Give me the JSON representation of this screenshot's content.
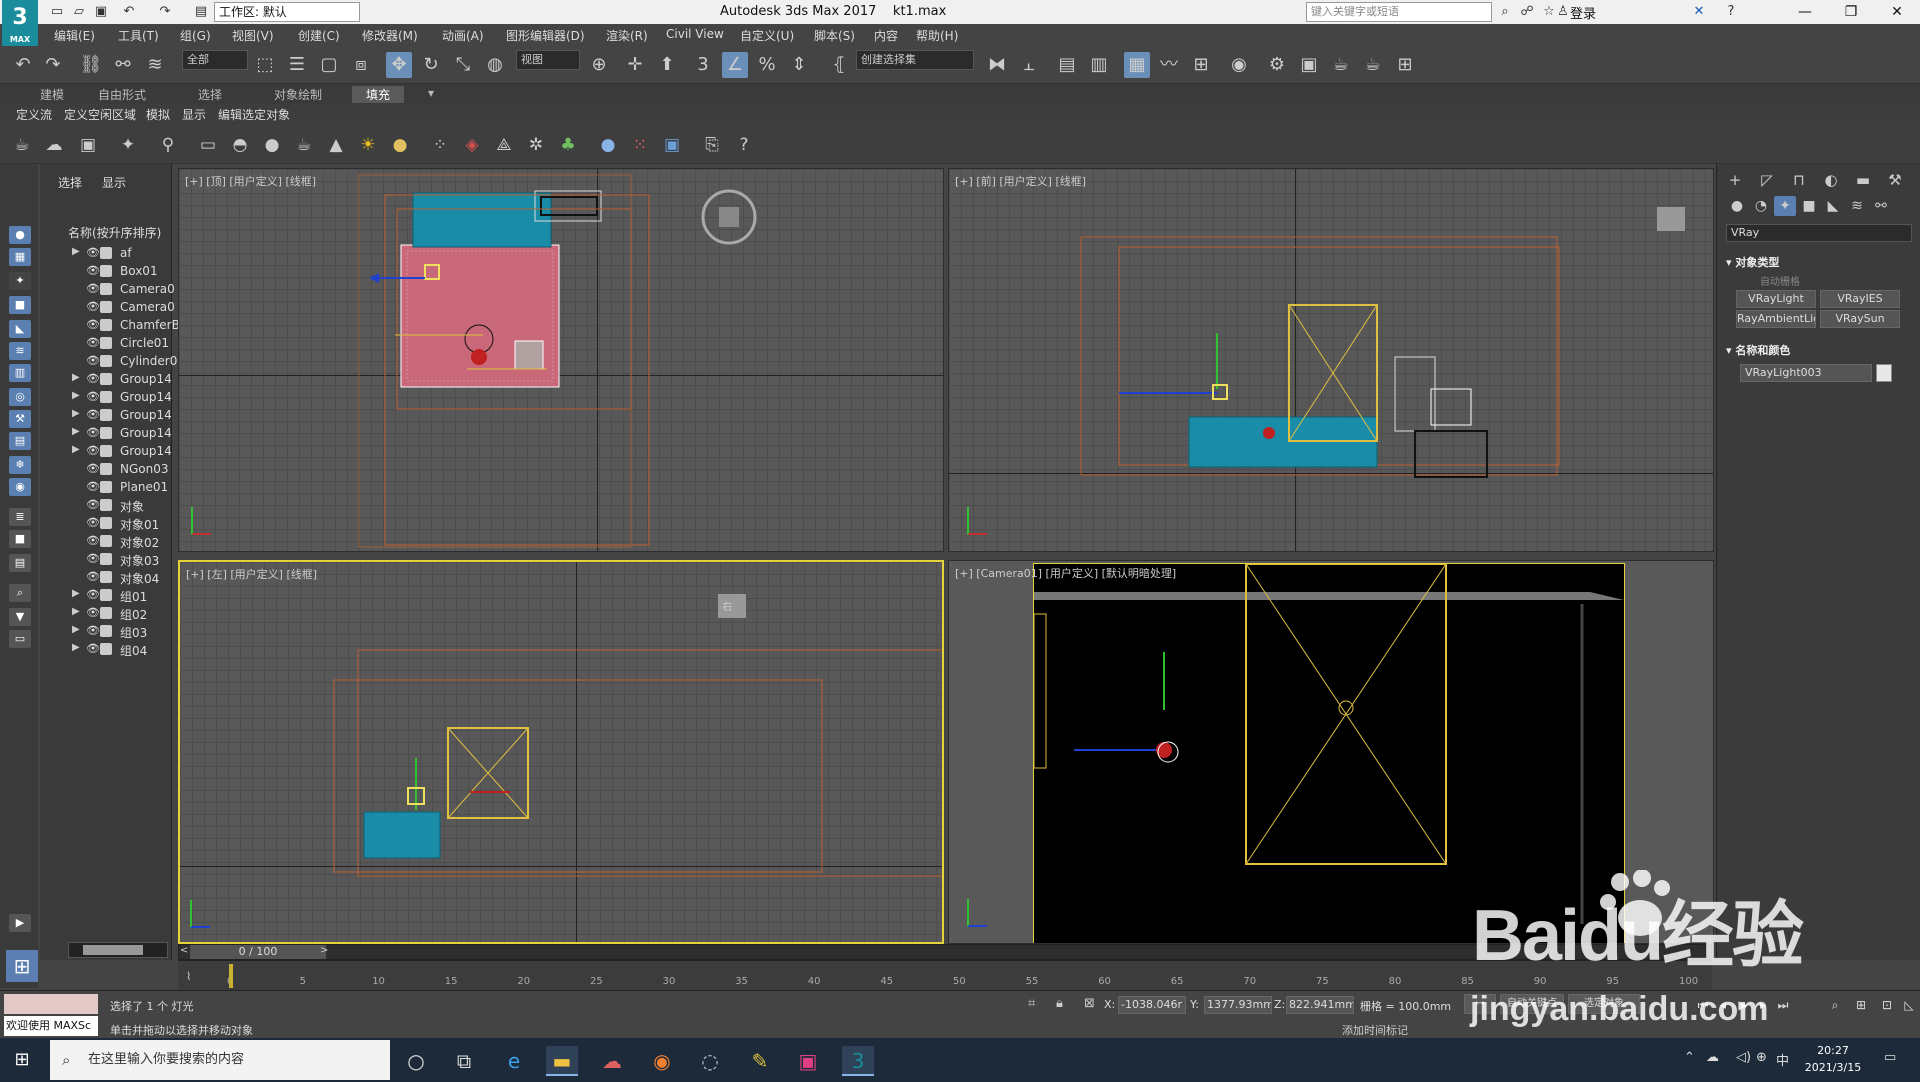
{
  "titlebar": {
    "logo_text": "3",
    "logo_sub": "MAX",
    "workspace": "工作区: 默认",
    "app_title": "Autodesk 3ds Max 2017",
    "file_name": "kt1.max",
    "search_placeholder": "键入关键字或短语",
    "login": "登录",
    "help": "?"
  },
  "menu": [
    "编辑(E)",
    "工具(T)",
    "组(G)",
    "视图(V)",
    "创建(C)",
    "修改器(M)",
    "动画(A)",
    "图形编辑器(D)",
    "渲染(R)",
    "Civil View",
    "自定义(U)",
    "脚本(S)",
    "内容",
    "帮助(H)"
  ],
  "toolbar": {
    "selection_filter": "全部",
    "ref_coord": "视图",
    "named_selection": "创建选择集"
  },
  "ribbon": {
    "tabs": [
      "建模",
      "自由形式",
      "选择",
      "对象绘制",
      "填充"
    ],
    "active_tab": "填充",
    "sub_items": [
      "定义流",
      "定义空闲区域",
      "模拟",
      "显示",
      "编辑选定对象"
    ]
  },
  "explorer": {
    "tabs": [
      "选择",
      "显示"
    ],
    "header": "名称(按升序排序)",
    "items": [
      {
        "name": "af",
        "expandable": true
      },
      {
        "name": "Box01",
        "expandable": false
      },
      {
        "name": "Camera0",
        "expandable": false
      },
      {
        "name": "Camera0",
        "expandable": false
      },
      {
        "name": "ChamferB",
        "expandable": false
      },
      {
        "name": "Circle01",
        "expandable": false
      },
      {
        "name": "Cylinder0",
        "expandable": false
      },
      {
        "name": "Group14",
        "expandable": true
      },
      {
        "name": "Group14",
        "expandable": true
      },
      {
        "name": "Group14",
        "expandable": true
      },
      {
        "name": "Group14",
        "expandable": true
      },
      {
        "name": "Group14",
        "expandable": true
      },
      {
        "name": "NGon03",
        "expandable": false
      },
      {
        "name": "Plane01",
        "expandable": false
      },
      {
        "name": "对象",
        "expandable": false
      },
      {
        "name": "对象01",
        "expandable": false
      },
      {
        "name": "对象02",
        "expandable": false
      },
      {
        "name": "对象03",
        "expandable": false
      },
      {
        "name": "对象04",
        "expandable": false
      },
      {
        "name": "组01",
        "expandable": true
      },
      {
        "name": "组02",
        "expandable": true
      },
      {
        "name": "组03",
        "expandable": true
      },
      {
        "name": "组04",
        "expandable": true
      }
    ]
  },
  "viewports": {
    "top": "[+] [顶] [用户定义] [线框]",
    "front": "[+] [前] [用户定义] [线框]",
    "left": "[+] [左] [用户定义] [线框]",
    "camera": "[+] [Camera01] [用户定义] [默认明暗处理]",
    "left_cube_label": "右"
  },
  "command_panel": {
    "category": "VRay",
    "rollout_object_type": "对象类型",
    "autogrid": "自动栅格",
    "buttons": [
      "VRayLight",
      "VRayIES",
      "RayAmbientLigh",
      "VRaySun"
    ],
    "rollout_name_color": "名称和颜色",
    "object_name": "VRayLight003",
    "object_color": "#e8e8e8"
  },
  "timeline": {
    "frame_counter": "0 / 100",
    "ticks": [
      "0",
      "5",
      "10",
      "15",
      "20",
      "25",
      "30",
      "35",
      "40",
      "45",
      "50",
      "55",
      "60",
      "65",
      "70",
      "75",
      "80",
      "85",
      "90",
      "95",
      "100"
    ]
  },
  "status": {
    "maxscript_welcome": "欢迎使用 MAXSc",
    "selected": "选择了 1 个 灯光",
    "prompt": "单击并拖动以选择并移动对象",
    "x_label": "X:",
    "x_value": "-1038.046r",
    "y_label": "Y:",
    "y_value": "1377.93mm",
    "z_label": "Z:",
    "z_value": "822.941mm",
    "grid": "栅格 = 100.0mm",
    "add_time_tag": "添加时间标记",
    "auto_key": "自动关键点",
    "set_key": "选定对象"
  },
  "taskbar": {
    "search_placeholder": "在这里输入你要搜索的内容",
    "time": "20:27",
    "date": "2021/3/15",
    "ime": "中"
  },
  "watermark": {
    "logo": "Baidu经验",
    "url": "jingyan.baidu.com"
  }
}
